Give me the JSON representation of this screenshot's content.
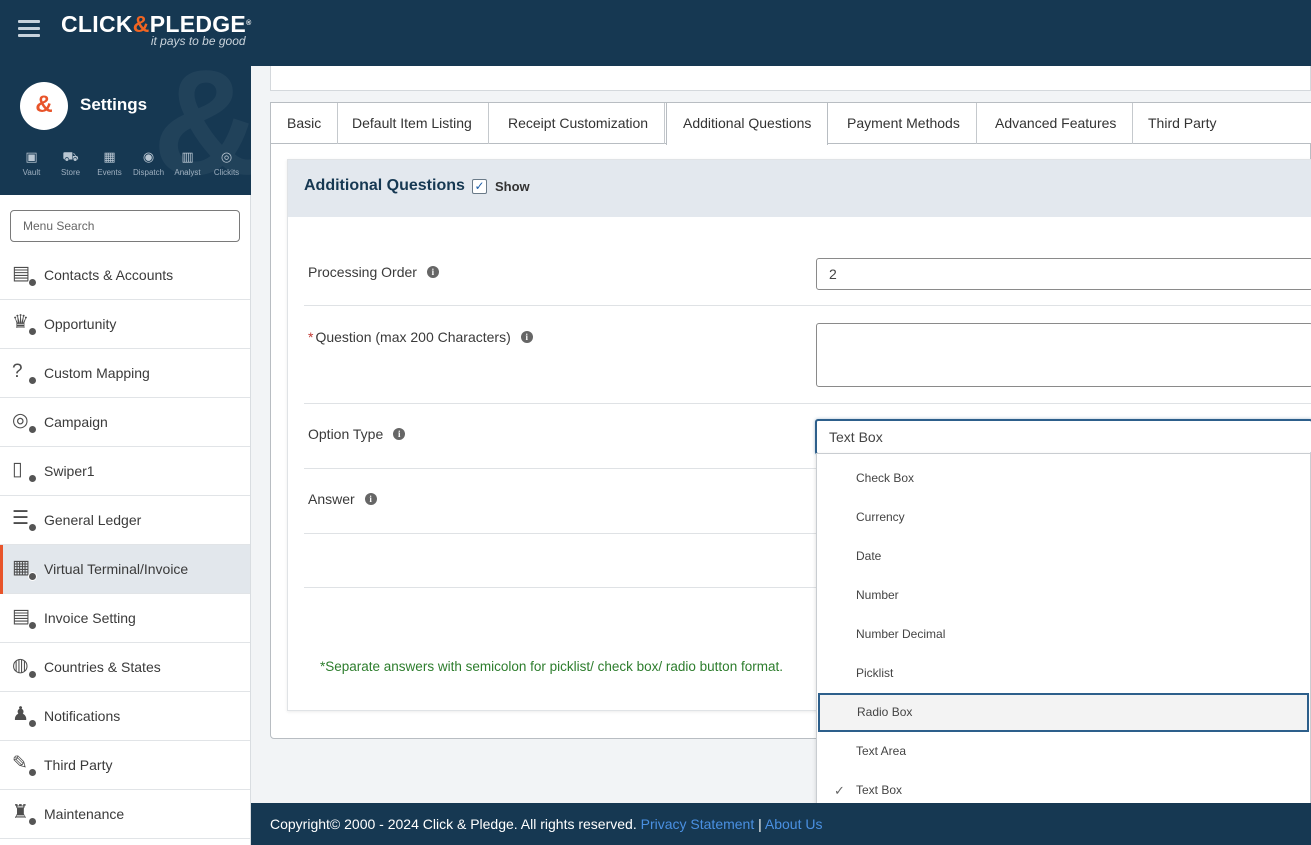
{
  "brand": {
    "name_left": "CLICK",
    "name_amp": "&",
    "name_right": "PLEDGE",
    "registered": "®",
    "tagline": "it pays to be good"
  },
  "sidebar": {
    "logo_glyph": "&",
    "title": "Settings",
    "apps": [
      {
        "label": "Vault",
        "icon": "vault-icon"
      },
      {
        "label": "Store",
        "icon": "cart-icon"
      },
      {
        "label": "Events",
        "icon": "calendar-icon"
      },
      {
        "label": "Dispatch",
        "icon": "broadcast-icon"
      },
      {
        "label": "Analyst",
        "icon": "bar-chart-icon"
      },
      {
        "label": "Clickits",
        "icon": "coin-icon"
      }
    ],
    "search_placeholder": "Menu Search",
    "items": [
      {
        "label": "Contacts & Accounts",
        "icon": "contacts-icon"
      },
      {
        "label": "Opportunity",
        "icon": "crown-icon"
      },
      {
        "label": "Custom Mapping",
        "icon": "mapping-icon"
      },
      {
        "label": "Campaign",
        "icon": "target-icon"
      },
      {
        "label": "Swiper1",
        "icon": "swiper-icon"
      },
      {
        "label": "General Ledger",
        "icon": "ledger-icon"
      },
      {
        "label": "Virtual Terminal/Invoice",
        "icon": "terminal-icon"
      },
      {
        "label": "Invoice Setting",
        "icon": "invoice-icon"
      },
      {
        "label": "Countries & States",
        "icon": "globe-icon"
      },
      {
        "label": "Notifications",
        "icon": "bell-icon"
      },
      {
        "label": "Third Party",
        "icon": "plug-icon"
      },
      {
        "label": "Maintenance",
        "icon": "maintenance-icon"
      }
    ],
    "active_item": "Virtual Terminal/Invoice"
  },
  "tabs": [
    {
      "label": "Basic"
    },
    {
      "label": "Default Item Listing"
    },
    {
      "label": "Receipt Customization"
    },
    {
      "label": "Additional Questions"
    },
    {
      "label": "Payment Methods"
    },
    {
      "label": "Advanced Features"
    },
    {
      "label": "Third Party"
    }
  ],
  "active_tab": "Additional Questions",
  "section": {
    "title": "Additional Questions",
    "show_label": "Show",
    "show_checked": true
  },
  "form": {
    "processing_order_label": "Processing Order",
    "processing_order_value": "2",
    "required_mark": "*",
    "question_label": "Question (max 200 Characters)",
    "question_value": "",
    "option_type_label": "Option Type",
    "option_type_value": "Text Box",
    "answer_label": "Answer",
    "note": "*Separate answers with semicolon for picklist/ check box/ radio button format."
  },
  "dropdown": {
    "options": [
      {
        "label": "Check Box"
      },
      {
        "label": "Currency"
      },
      {
        "label": "Date"
      },
      {
        "label": "Number"
      },
      {
        "label": "Number Decimal"
      },
      {
        "label": "Picklist"
      },
      {
        "label": "Radio Box"
      },
      {
        "label": "Text Area"
      },
      {
        "label": "Text Box"
      }
    ],
    "highlighted": "Radio Box",
    "selected": "Text Box",
    "check_glyph": "✓"
  },
  "footer": {
    "copyright": "Copyright© 2000 - 2024 Click & Pledge. All rights reserved.",
    "privacy_link": "Privacy Statement",
    "separator": "|",
    "about_link": "About Us"
  },
  "colors": {
    "navy": "#163852",
    "accent_orange": "#e8542a",
    "link_blue": "#4a90e2",
    "note_green": "#2d7d2d",
    "focus_blue": "#2d5f8b"
  }
}
